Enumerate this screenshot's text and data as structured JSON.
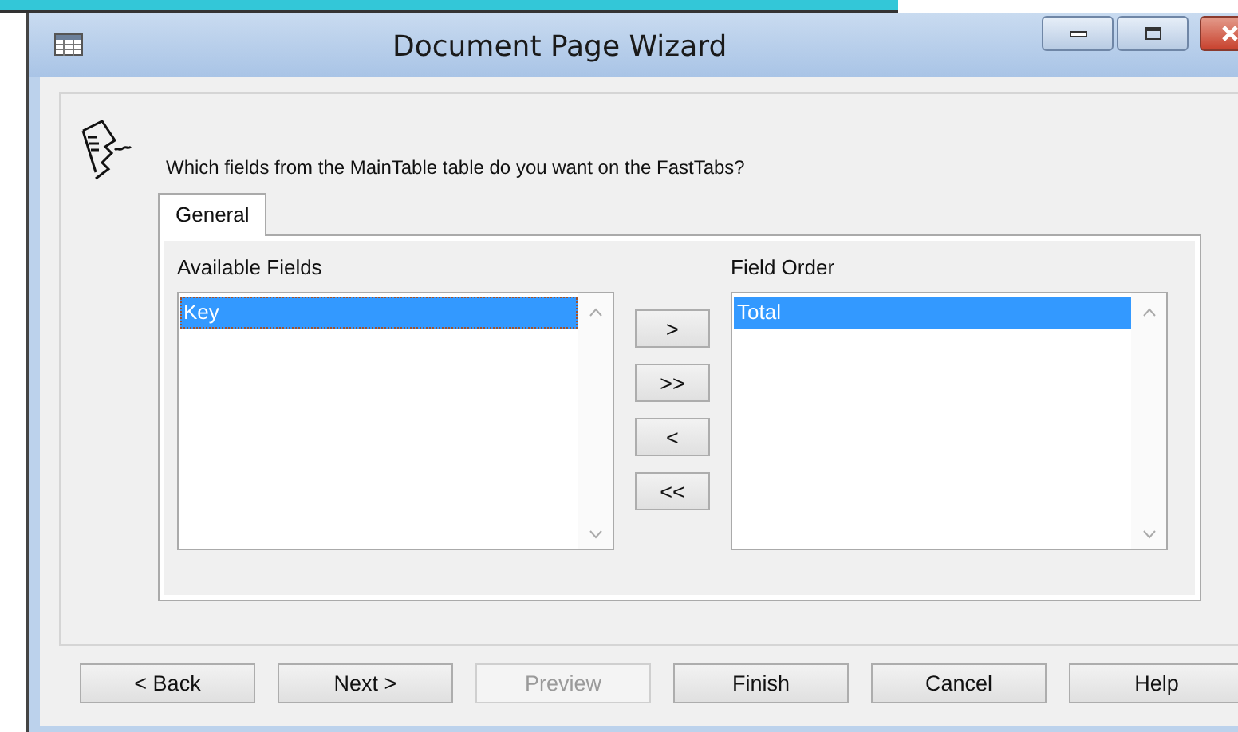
{
  "window": {
    "title": "Document Page Wizard"
  },
  "prompt": "Which fields from the MainTable table do you want on the FastTabs?",
  "tabs": [
    {
      "label": "General",
      "selected": true
    }
  ],
  "available_fields": {
    "label": "Available Fields",
    "items": [
      {
        "text": "Key",
        "selected": true,
        "focused": true
      }
    ]
  },
  "move_buttons": [
    ">",
    ">>",
    "<",
    "<<"
  ],
  "field_order": {
    "label": "Field Order",
    "items": [
      {
        "text": "Total",
        "selected": true,
        "focused": false
      }
    ]
  },
  "buttons": [
    {
      "label": "< Back",
      "disabled": false
    },
    {
      "label": "Next >",
      "disabled": false
    },
    {
      "label": "Preview",
      "disabled": true
    },
    {
      "label": "Finish",
      "disabled": false
    },
    {
      "label": "Cancel",
      "disabled": false
    },
    {
      "label": "Help",
      "disabled": false
    }
  ]
}
